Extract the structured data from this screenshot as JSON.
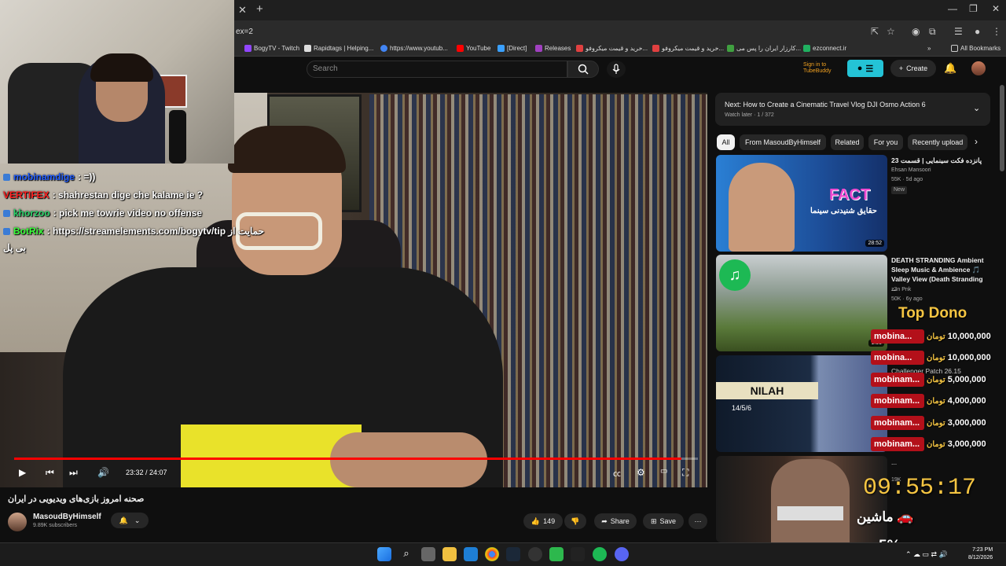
{
  "browser": {
    "url_fragment": "ex=2",
    "bookmarks": [
      {
        "label": "BogyTV - Twitch",
        "color": "#9146ff"
      },
      {
        "label": "Rapidtags | Helping...",
        "color": "#ddd"
      },
      {
        "label": "https://www.youtub...",
        "color": "#4285f4"
      },
      {
        "label": "YouTube",
        "color": "#ff0000"
      },
      {
        "label": "[Direct]",
        "color": "#3aa0ff"
      },
      {
        "label": "Releases",
        "color": "#a040c0"
      },
      {
        "label": "خرید و قیمت میکروفو...",
        "color": "#e04040"
      },
      {
        "label": "خرید و قیمت میکروفو...",
        "color": "#e04040"
      },
      {
        "label": "کارزار ایران را پس می...",
        "color": "#40a040"
      },
      {
        "label": "ezconnect.ir",
        "color": "#20b060"
      }
    ],
    "all_bookmarks": "All Bookmarks"
  },
  "youtube": {
    "search_placeholder": "Search",
    "signin_line1": "Sign in to",
    "signin_line2": "TubeBuddy",
    "create_label": "Create"
  },
  "player": {
    "current_time": "23:32 / 24:07",
    "progress": 0.976
  },
  "chat": [
    {
      "user": "mobinamdige",
      "user_color": "#1e5bff",
      "text": ": =))"
    },
    {
      "user": "VERTIFEX",
      "user_color": "#ff2020",
      "text": ": shahrestan dige che kalame ie ?"
    },
    {
      "user": "khorzoo",
      "user_color": "#2ad36a",
      "text": ": pick me towrie video no offense"
    },
    {
      "user": "BotRix",
      "user_color": "#3aff3a",
      "text": ": https://streamelements.com/bogytv/tip حمایت از"
    },
    {
      "user": "",
      "user_color": "#fff",
      "text": "بی پل"
    }
  ],
  "video": {
    "title": "صحنه امروز بازی‌های ویدیویی در ایران",
    "channel": "MasoudByHimself",
    "subscribers": "9.89K subscribers",
    "likes": "149",
    "share": "Share",
    "save": "Save"
  },
  "next_up": {
    "title": "Next: How to Create a Cinematic Travel Vlog DJI Osmo Action 6",
    "subtitle": "Watch later · 1 / 372"
  },
  "chips": [
    "All",
    "From MasoudByHimself",
    "Related",
    "For you",
    "Recently upload"
  ],
  "recommendations": [
    {
      "title": "پانزده فکت سینمایی | قسمت 23",
      "channel": "Ehsan Mansoori",
      "meta": "55K · 5d ago",
      "badge": "New",
      "duration": "28:52",
      "thumb_text": "FACT",
      "thumb_sub": "حقایق شنیدنی سینما"
    },
    {
      "title": "DEATH STRANDING Ambient Sleep Music & Ambience 🎵 Valley View (Death Stranding ...",
      "channel": "z3n Pnk",
      "meta": "50K · 6y ago",
      "badge": "",
      "duration": "1:00",
      "thumb_text": "",
      "thumb_sub": ""
    },
    {
      "title": "Challenger Patch 26.15",
      "channel": "",
      "meta": "",
      "badge": "",
      "duration": "25",
      "thumb_text": "NILAH",
      "thumb_sub": "14/5/6"
    },
    {
      "title": "...",
      "channel": "",
      "meta": "19K",
      "badge": "",
      "duration": "",
      "thumb_text": "",
      "thumb_sub": ""
    }
  ],
  "overlay": {
    "top_dono": "Top Dono",
    "donations": [
      {
        "name": "mobina...",
        "unit": "تومان",
        "amount": "10,000,000"
      },
      {
        "name": "mobina...",
        "unit": "تومان",
        "amount": "10,000,000"
      },
      {
        "name": "mobinam...",
        "unit": "تومان",
        "amount": "5,000,000"
      },
      {
        "name": "mobinam...",
        "unit": "تومان",
        "amount": "4,000,000"
      },
      {
        "name": "mobinam...",
        "unit": "تومان",
        "amount": "3,000,000"
      },
      {
        "name": "mobinam...",
        "unit": "تومان",
        "amount": "3,000,000"
      }
    ],
    "timer": "09:55:17",
    "goal_label": "ماشین 🚗",
    "goal_percent": "5%"
  },
  "taskbar": {
    "time": "7:23 PM",
    "date": "8/12/2026"
  }
}
